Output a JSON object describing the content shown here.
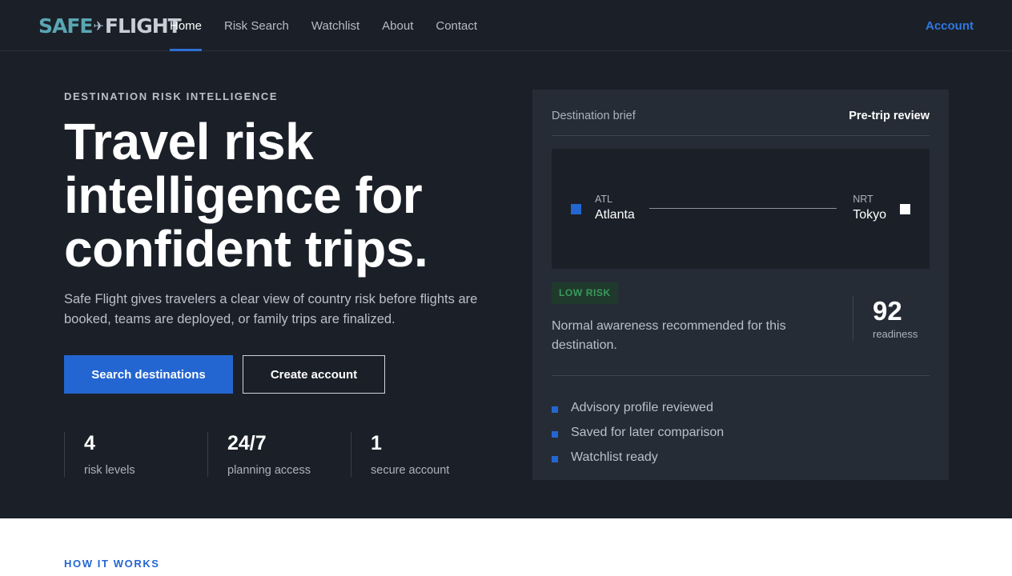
{
  "brand": {
    "logo_left": "SAFE",
    "logo_glyph": "✈",
    "logo_right": "FLIGHT"
  },
  "nav": {
    "items": [
      {
        "label": "Home",
        "active": true
      },
      {
        "label": "Risk Search"
      },
      {
        "label": "Watchlist"
      },
      {
        "label": "About"
      },
      {
        "label": "Contact"
      }
    ],
    "account": "Account"
  },
  "hero": {
    "eyebrow": "DESTINATION RISK INTELLIGENCE",
    "headline_line1": "Travel risk",
    "headline_line2": "intelligence for",
    "headline_line3": "confident trips.",
    "lede": "Safe Flight gives travelers a clear view of country risk before flights are booked, teams are deployed, or family trips are finalized.",
    "primary_cta": "Search destinations",
    "secondary_cta": "Create account",
    "stats": [
      {
        "value": "4",
        "label": "risk levels"
      },
      {
        "value": "24/7",
        "label": "planning access"
      },
      {
        "value": "1",
        "label": "secure account"
      }
    ]
  },
  "brief": {
    "title": "Destination brief",
    "mode": "Pre-trip review",
    "origin": {
      "code": "ATL",
      "city": "Atlanta"
    },
    "destination": {
      "code": "NRT",
      "city": "Tokyo"
    },
    "risk_badge": "LOW RISK",
    "risk_text": "Normal awareness recommended for this destination.",
    "score": "92",
    "score_label": "readiness",
    "checklist": [
      "Advisory profile reviewed",
      "Saved for later comparison",
      "Watchlist ready"
    ]
  },
  "section": {
    "how_it_works": "HOW IT WORKS"
  },
  "colors": {
    "accent": "#2466d1",
    "background": "#1b2028",
    "panel": "#262c36",
    "low_risk": "#3a9a5c"
  }
}
